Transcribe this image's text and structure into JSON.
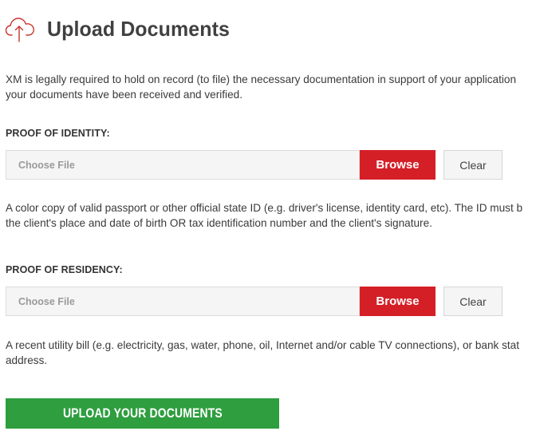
{
  "header": {
    "icon": "cloud-upload-icon",
    "title": "Upload Documents"
  },
  "intro": {
    "line1": "XM is legally required to hold on record (to file) the necessary documentation in support of your application",
    "line2": "your documents have been received and verified."
  },
  "identity": {
    "label": "PROOF OF IDENTITY:",
    "placeholder": "Choose File",
    "browse_label": "Browse",
    "clear_label": "Clear",
    "desc_line1": "A color copy of valid passport or other official state ID (e.g. driver's license, identity card, etc). The ID must b",
    "desc_line2": "the client's place and date of birth OR tax identification number and the client's signature."
  },
  "residency": {
    "label": "PROOF OF RESIDENCY:",
    "placeholder": "Choose File",
    "browse_label": "Browse",
    "clear_label": "Clear",
    "desc_line1": "A recent utility bill (e.g. electricity, gas, water, phone, oil, Internet and/or cable TV connections), or bank stat",
    "desc_line2": "address."
  },
  "upload": {
    "label": "UPLOAD YOUR DOCUMENTS"
  },
  "colors": {
    "brand_red": "#d41f26",
    "upload_green": "#2e9e3f",
    "icon_red": "#c9342f"
  }
}
